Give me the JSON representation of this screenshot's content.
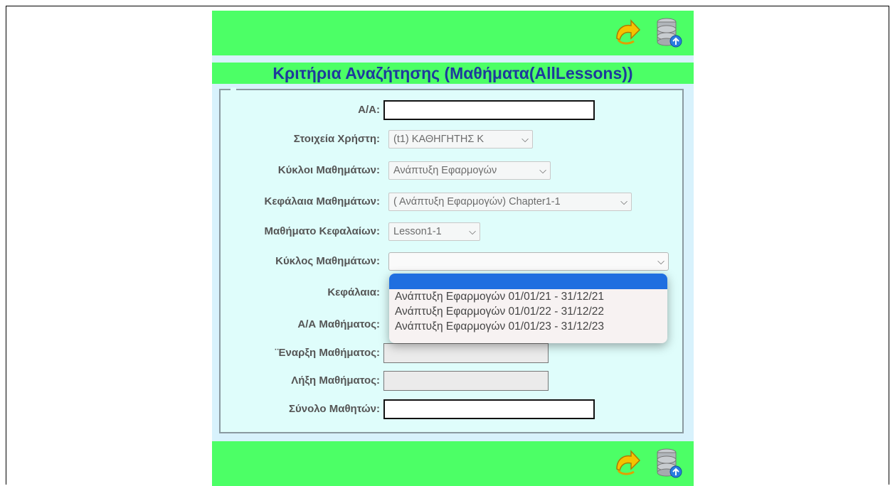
{
  "page": {
    "title": "Κριτήρια Αναζήτησης (Μαθήματα(AllLessons))"
  },
  "toolbar_icons": [
    "redo-arrow-icon",
    "database-icon"
  ],
  "colors": {
    "bar_green": "#4cff66",
    "title_blue": "#1e3a9c",
    "panel_bg": "#dffdfb",
    "highlight": "#1f6fe0"
  },
  "fields": {
    "aa": {
      "label": "Α/Α:",
      "value": ""
    },
    "user": {
      "label": "Στοιχεία Χρήστη:",
      "value": "(t1) ΚΑΘΗΓΗΤΗΣ Κ"
    },
    "cycles": {
      "label": "Κύκλοι Μαθημάτων:",
      "value": "Ανάπτυξη Εφαρμογών"
    },
    "chapters": {
      "label": "Κεφάλαια Μαθημάτων:",
      "value": "( Ανάπτυξη Εφαρμογών) Chapter1-1"
    },
    "lesson_chapter": {
      "label": "Μαθήματο Κεφαλαίων:",
      "value": "Lesson1-1"
    },
    "cycle": {
      "label": "Κύκλος Μαθημάτων:",
      "value": ""
    },
    "chapter": {
      "label": "Κεφάλαια:"
    },
    "lesson_no": {
      "label": "Α/Α Μαθήματος:"
    },
    "start": {
      "label": "¨Εναρξη Μαθήματος:",
      "value": ""
    },
    "end": {
      "label": "Λήξη Μαθήματος:",
      "value": ""
    },
    "total": {
      "label": "Σύνολο Μαθητών:",
      "value": ""
    }
  },
  "cycle_dropdown": {
    "options": [
      "",
      "Ανάπτυξη Εφαρμογών 01/01/21 - 31/12/21",
      "Ανάπτυξη Εφαρμογών 01/01/22 - 31/12/22",
      "Ανάπτυξη Εφαρμογών 01/01/23 - 31/12/23"
    ]
  }
}
